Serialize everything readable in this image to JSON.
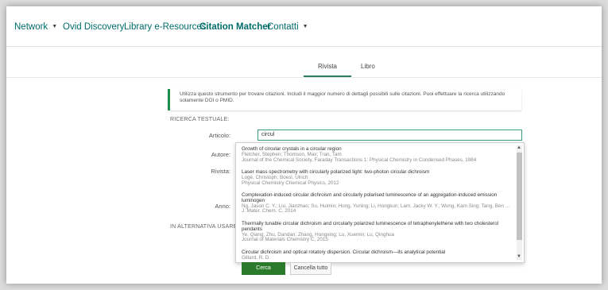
{
  "nav": {
    "network": "Network",
    "ovid_discovery": "Ovid Discovery",
    "library_eresources": "Library e-Resources",
    "citation_matcher": "Citation Matcher",
    "contatti": "Contatti"
  },
  "tabs": {
    "rivista": "Rivista",
    "libro": "Libro"
  },
  "info_text": "Utilizza questo strumento per trovare citazioni. Includi il maggior numero di dettagli possibili sulle citazioni. Puoi effettuare la ricerca utilizzando solamente DOI o PMID.",
  "section_text": "RICERCA TESTUALE:",
  "section_alt": "IN ALTERNATIVA USARE:",
  "labels": {
    "articolo": "Articolo:",
    "autore": "Autore:",
    "rivista": "Rivista:",
    "anno": "Anno:"
  },
  "search": {
    "value": "circul"
  },
  "suggestions": [
    {
      "title": "Growth of circular crystals in a circular region",
      "authors": "Fletcher, Stephen; Thomson, Max; Tran, Tam",
      "source": "Journal of the Chemical Society, Faraday Transactions 1: Physical Chemistry in Condensed Phases, 1984"
    },
    {
      "title": "Laser mass spectrometry with circularly polarized light: two-photon circular dichroism",
      "authors": "Logé, Christoph; Boesl, Ulrich",
      "source": "Physical Chemistry Chemical Physics, 2012"
    },
    {
      "title": "Complexation-induced circular dichroism and circularly polarised luminescence of an aggregation-induced emission luminogen",
      "authors": "Ng, Jason C. Y.; Liu, Jianzhao; Su, Huimin; Hong, Yuning; Li, Hongkun; Lam, Jacky W. Y.; Wong, Kam Sing; Tang, Ben ...",
      "source": "J. Mater. Chem. C, 2014"
    },
    {
      "title": "Thermally tunable circular dichroism and circularly polarized luminescence of tetraphenylethene with two cholesterol pendants",
      "authors": "Ye, Qiang; Zhu, Dandan; Zhang, Hongxing; Lu, Xuemin; Lu, Qinghua",
      "source": "Journal of Materials Chemistry C, 2015"
    },
    {
      "title": "Circular dichroism and optical rotatory dispersion. Circular dichroism—its analytical potential",
      "authors": "Gillard, R. D.",
      "source": ""
    }
  ],
  "buttons": {
    "cerca": "Cerca",
    "cancella": "Cancella tutto"
  },
  "colors": {
    "accent": "#1e8c4a",
    "nav_link": "#006b6b",
    "button": "#2b7a2b"
  }
}
